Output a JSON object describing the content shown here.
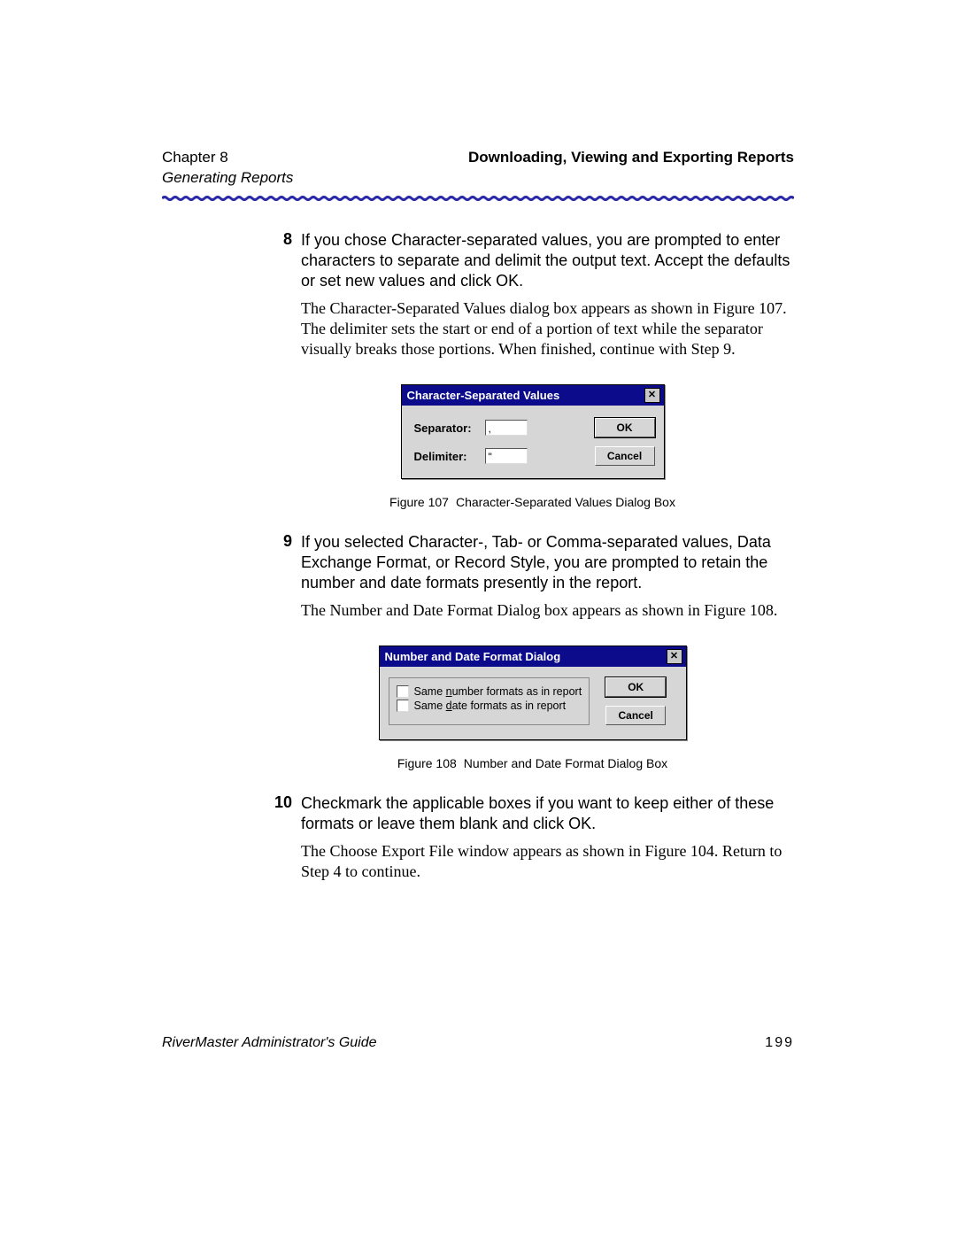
{
  "header": {
    "chapter": "Chapter 8",
    "subtitle": "Generating Reports",
    "right": "Downloading, Viewing and Exporting Reports"
  },
  "steps": {
    "s8": {
      "num": "8",
      "sans": "If you chose Character-separated values, you are prompted to enter characters to separate and delimit the output text. Accept the defaults or set new values and click OK.",
      "serif": "The Character-Separated Values dialog box appears as shown in Figure 107. The delimiter sets the start or end of a portion of text while the separator visually breaks those portions. When finished, continue with Step 9."
    },
    "s9": {
      "num": "9",
      "sans": "If you selected Character-, Tab- or Comma-separated values, Data Exchange Format, or Record Style, you are prompted to retain the number and date formats presently in the report.",
      "serif": "The Number and Date Format Dialog box appears as shown in Figure 108."
    },
    "s10": {
      "num": "10",
      "sans": "Checkmark the applicable boxes if you want to keep either of these formats or leave them blank and click OK.",
      "serif": "The Choose Export File window appears as shown in Figure 104. Return to Step 4 to continue."
    }
  },
  "dialog1": {
    "title": "Character-Separated Values",
    "separator_label": "Separator:",
    "separator_value": ",",
    "delimiter_label": "Delimiter:",
    "delimiter_value": "\"",
    "ok": "OK",
    "cancel": "Cancel"
  },
  "fig107": {
    "label": "Figure 107",
    "caption": "Character-Separated Values Dialog Box"
  },
  "dialog2": {
    "title": "Number and Date Format Dialog",
    "chk_number_pre": "Same ",
    "chk_number_acc": "n",
    "chk_number_post": "umber formats as in report",
    "chk_date_pre": "Same ",
    "chk_date_acc": "d",
    "chk_date_post": "ate formats as in report",
    "ok": "OK",
    "cancel": "Cancel"
  },
  "fig108": {
    "label": "Figure 108",
    "caption": "Number and Date Format Dialog Box"
  },
  "footer": {
    "guide": "RiverMaster Administrator's Guide",
    "page": "199"
  }
}
